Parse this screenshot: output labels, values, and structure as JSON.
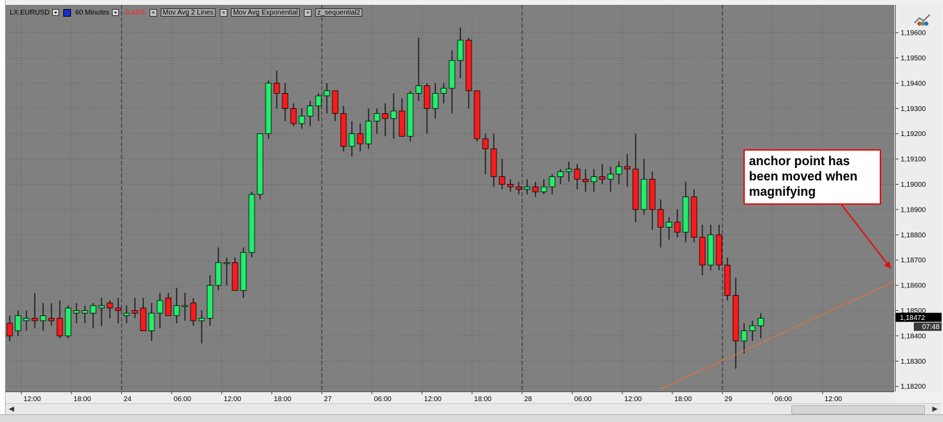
{
  "toolbar": {
    "symbol": "LX.EURUSD",
    "interval": "60 Minutes",
    "change": "-0,43%",
    "indicators": [
      "Mov Avg 2 Lines",
      "Mov Avg Exponential",
      "z_sequential2"
    ],
    "close_glyph": "×"
  },
  "annotation": {
    "lines": [
      "anchor point has",
      "been moved when",
      "magnifying"
    ]
  },
  "last_price": {
    "price": "1,18472",
    "time": "07:48"
  },
  "colors": {
    "plot_bg": "#808080",
    "up_candle": "#21f06a",
    "down_candle": "#ff1a1a",
    "wick": "#000000",
    "trendline": "#f07030",
    "annotation_border": "#e21010",
    "arrow": "#e21010",
    "last_price_bg": "#000000"
  },
  "chart_data": {
    "type": "candlestick",
    "title": "",
    "xlabel": "",
    "ylabel": "",
    "ylim": [
      1.1818,
      1.1971
    ],
    "y_ticks": [
      "1,19600",
      "1,19500",
      "1,19400",
      "1,19300",
      "1,19200",
      "1,19100",
      "1,19000",
      "1,18900",
      "1,18800",
      "1,18700",
      "1,18600",
      "1,18500",
      "1,18400",
      "1,18300",
      "1,18200"
    ],
    "x_ticks": [
      "12:00",
      "18:00",
      "24",
      "06:00",
      "12:00",
      "18:00",
      "27",
      "06:00",
      "12:00",
      "18:00",
      "28",
      "06:00",
      "12:00",
      "18:00",
      "29",
      "06:00",
      "12:00"
    ],
    "day_separators": [
      "24",
      "27",
      "28",
      "29"
    ],
    "grid": true,
    "candles": [
      [
        1.1845,
        1.1848,
        1.1838,
        1.184
      ],
      [
        1.1842,
        1.185,
        1.184,
        1.1848
      ],
      [
        1.1846,
        1.185,
        1.1842,
        1.1847
      ],
      [
        1.1847,
        1.1857,
        1.1843,
        1.1846
      ],
      [
        1.1846,
        1.1853,
        1.1842,
        1.1848
      ],
      [
        1.1847,
        1.1853,
        1.1844,
        1.1846
      ],
      [
        1.1847,
        1.1854,
        1.1839,
        1.184
      ],
      [
        1.184,
        1.1852,
        1.1839,
        1.1851
      ],
      [
        1.1849,
        1.1853,
        1.1845,
        1.185
      ],
      [
        1.1849,
        1.1852,
        1.1845,
        1.185
      ],
      [
        1.1849,
        1.1853,
        1.1843,
        1.1852
      ],
      [
        1.1851,
        1.1855,
        1.1844,
        1.1852
      ],
      [
        1.1853,
        1.1854,
        1.1847,
        1.1851
      ],
      [
        1.1851,
        1.1855,
        1.1845,
        1.185
      ],
      [
        1.1848,
        1.1852,
        1.1845,
        1.1849
      ],
      [
        1.185,
        1.1855,
        1.1847,
        1.1849
      ],
      [
        1.1851,
        1.1855,
        1.1843,
        1.1842
      ],
      [
        1.1842,
        1.1853,
        1.1838,
        1.1849
      ],
      [
        1.1849,
        1.1857,
        1.1843,
        1.1854
      ],
      [
        1.1855,
        1.1857,
        1.185,
        1.1848
      ],
      [
        1.1848,
        1.1859,
        1.1845,
        1.1852
      ],
      [
        1.1852,
        1.1857,
        1.1846,
        1.1852
      ],
      [
        1.1853,
        1.1855,
        1.1844,
        1.1846
      ],
      [
        1.1846,
        1.185,
        1.1837,
        1.1847
      ],
      [
        1.1847,
        1.1864,
        1.1844,
        1.186
      ],
      [
        1.186,
        1.1875,
        1.1858,
        1.1869
      ],
      [
        1.1869,
        1.1871,
        1.186,
        1.1869
      ],
      [
        1.1869,
        1.1871,
        1.1858,
        1.1858
      ],
      [
        1.1858,
        1.1875,
        1.1855,
        1.1873
      ],
      [
        1.1873,
        1.1897,
        1.1871,
        1.1896
      ],
      [
        1.1896,
        1.192,
        1.1894,
        1.192
      ],
      [
        1.192,
        1.1941,
        1.1918,
        1.194
      ],
      [
        1.194,
        1.1945,
        1.193,
        1.1936
      ],
      [
        1.1936,
        1.194,
        1.1925,
        1.193
      ],
      [
        1.193,
        1.1932,
        1.1923,
        1.1924
      ],
      [
        1.1924,
        1.193,
        1.1922,
        1.1927
      ],
      [
        1.1927,
        1.1933,
        1.1923,
        1.1931
      ],
      [
        1.1931,
        1.1936,
        1.1925,
        1.1935
      ],
      [
        1.1935,
        1.194,
        1.1928,
        1.1937
      ],
      [
        1.1937,
        1.1935,
        1.1925,
        1.1928
      ],
      [
        1.1928,
        1.1931,
        1.1913,
        1.1915
      ],
      [
        1.1915,
        1.1925,
        1.1911,
        1.192
      ],
      [
        1.192,
        1.1924,
        1.1913,
        1.1916
      ],
      [
        1.1916,
        1.193,
        1.1914,
        1.1925
      ],
      [
        1.1925,
        1.193,
        1.192,
        1.1928
      ],
      [
        1.1928,
        1.1932,
        1.1919,
        1.1926
      ],
      [
        1.1926,
        1.1936,
        1.1918,
        1.1929
      ],
      [
        1.1929,
        1.1934,
        1.192,
        1.1919
      ],
      [
        1.1919,
        1.1937,
        1.1917,
        1.1936
      ],
      [
        1.1936,
        1.1958,
        1.1933,
        1.1939
      ],
      [
        1.1939,
        1.194,
        1.192,
        1.193
      ],
      [
        1.193,
        1.194,
        1.1926,
        1.1936
      ],
      [
        1.1936,
        1.194,
        1.1932,
        1.1938
      ],
      [
        1.1938,
        1.1953,
        1.1928,
        1.1949
      ],
      [
        1.1949,
        1.1962,
        1.1942,
        1.1957
      ],
      [
        1.1957,
        1.1958,
        1.193,
        1.1937
      ],
      [
        1.1937,
        1.1937,
        1.1917,
        1.1918
      ],
      [
        1.1918,
        1.192,
        1.1904,
        1.1914
      ],
      [
        1.1914,
        1.192,
        1.1899,
        1.1903
      ],
      [
        1.1903,
        1.191,
        1.1898,
        1.19
      ],
      [
        1.19,
        1.1902,
        1.1897,
        1.1899
      ],
      [
        1.1899,
        1.1901,
        1.1896,
        1.1898
      ],
      [
        1.1898,
        1.1902,
        1.1896,
        1.1899
      ],
      [
        1.1899,
        1.1901,
        1.1895,
        1.1897
      ],
      [
        1.1897,
        1.1902,
        1.1896,
        1.1899
      ],
      [
        1.1899,
        1.1904,
        1.1896,
        1.1903
      ],
      [
        1.1903,
        1.1906,
        1.19,
        1.1905
      ],
      [
        1.1905,
        1.1909,
        1.1901,
        1.1906
      ],
      [
        1.1906,
        1.1908,
        1.1898,
        1.1902
      ],
      [
        1.1902,
        1.1906,
        1.1897,
        1.1901
      ],
      [
        1.1901,
        1.1906,
        1.1897,
        1.1903
      ],
      [
        1.1903,
        1.1908,
        1.19,
        1.1902
      ],
      [
        1.1902,
        1.1907,
        1.1897,
        1.1904
      ],
      [
        1.1904,
        1.1909,
        1.19,
        1.1907
      ],
      [
        1.1907,
        1.1912,
        1.1899,
        1.1906
      ],
      [
        1.1906,
        1.192,
        1.1885,
        1.189
      ],
      [
        1.189,
        1.191,
        1.1888,
        1.1902
      ],
      [
        1.1902,
        1.1905,
        1.1882,
        1.189
      ],
      [
        1.189,
        1.1894,
        1.1875,
        1.1883
      ],
      [
        1.1883,
        1.1887,
        1.1878,
        1.1885
      ],
      [
        1.1885,
        1.189,
        1.1879,
        1.1881
      ],
      [
        1.1881,
        1.1901,
        1.1877,
        1.1895
      ],
      [
        1.1895,
        1.1898,
        1.1877,
        1.1879
      ],
      [
        1.1879,
        1.1884,
        1.1864,
        1.1868
      ],
      [
        1.1868,
        1.1884,
        1.1866,
        1.188
      ],
      [
        1.188,
        1.1884,
        1.1866,
        1.1868
      ],
      [
        1.1868,
        1.1871,
        1.1854,
        1.1856
      ],
      [
        1.1856,
        1.1863,
        1.1827,
        1.1838
      ],
      [
        1.1838,
        1.1845,
        1.1833,
        1.1842
      ],
      [
        1.1842,
        1.1846,
        1.1838,
        1.1844
      ],
      [
        1.1844,
        1.1849,
        1.1839,
        1.1847
      ]
    ],
    "trendline": {
      "x0": 78.0,
      "y0": 1.1819,
      "x1": 107.0,
      "y1": 1.1863
    },
    "last_value": 1.18472
  }
}
